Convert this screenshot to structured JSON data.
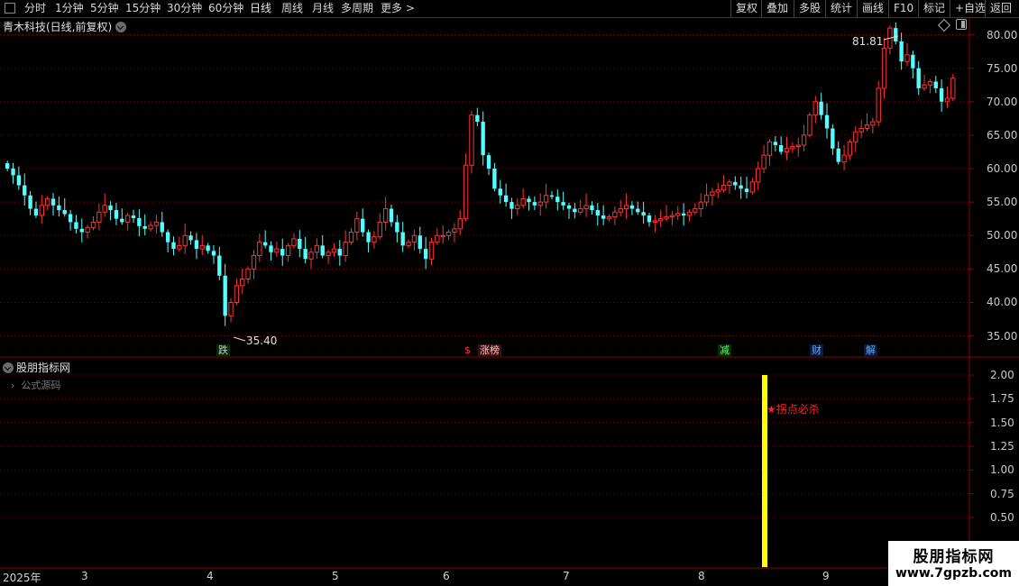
{
  "toolbar": {
    "periods": [
      "分时",
      "1分钟",
      "5分钟",
      "15分钟",
      "30分钟",
      "60分钟",
      "日线",
      "周线",
      "月线",
      "多周期",
      "更多"
    ],
    "active_period": "日线",
    "right_buttons": [
      "复权",
      "叠加",
      "多股",
      "统计",
      "画线",
      "F10",
      "标记",
      "+自选",
      "返回"
    ]
  },
  "main_chart": {
    "title": "青木科技(日线,前复权)",
    "high_label": "81.81",
    "low_label": "35.40",
    "markers": [
      {
        "text": "跌",
        "color": "#00cc00"
      },
      {
        "text": "$",
        "color": "#ff3333"
      },
      {
        "text": "涨榜",
        "color": "#ff3333"
      },
      {
        "text": "减",
        "color": "#00cc00"
      },
      {
        "text": "财",
        "color": "#3399ff"
      },
      {
        "text": "解",
        "color": "#3399ff"
      }
    ]
  },
  "indicator_panel": {
    "title": "股朋指标网",
    "source_label": "公式源码",
    "signal_text": "★拐点必杀",
    "signal_value": 2.0
  },
  "x_axis": [
    "2025年",
    "3",
    "4",
    "5",
    "6",
    "7",
    "8",
    "9"
  ],
  "watermark": {
    "line1": "股朋指标网",
    "line2": "www.7gpzb.com"
  },
  "colors": {
    "up": "#ff3333",
    "down": "#54ffff",
    "signal": "#ffff00",
    "grid": "#8b0000"
  },
  "chart_data": [
    {
      "type": "candlestick",
      "title": "青木科技(日线,前复权)",
      "y_axis_ticks": [
        35.0,
        40.0,
        45.0,
        50.0,
        55.0,
        60.0,
        65.0,
        70.0,
        75.0,
        80.0
      ],
      "ylim": [
        34,
        82.5
      ],
      "x_ticks": [
        "2025年",
        "3",
        "4",
        "5",
        "6",
        "7",
        "8",
        "9"
      ],
      "close": [
        60.0,
        59.0,
        57.5,
        56.0,
        54.0,
        53.0,
        54.5,
        55.5,
        54.5,
        53.8,
        53.2,
        52.0,
        51.0,
        50.5,
        51.2,
        52.0,
        53.5,
        54.5,
        53.8,
        52.5,
        52.0,
        53.0,
        52.6,
        51.4,
        51.0,
        51.5,
        52.0,
        50.5,
        49.0,
        48.0,
        48.5,
        50.0,
        49.3,
        48.0,
        48.5,
        47.7,
        47.0,
        44.0,
        38.0,
        40.0,
        42.5,
        43.5,
        45.0,
        47.0,
        49.0,
        48.5,
        47.5,
        48.0,
        47.0,
        48.5,
        49.5,
        48.0,
        46.5,
        47.5,
        48.5,
        47.0,
        47.5,
        48.0,
        47.0,
        49.0,
        50.5,
        52.5,
        50.5,
        49.0,
        49.8,
        52.0,
        54.0,
        52.0,
        50.5,
        48.5,
        49.0,
        50.0,
        48.0,
        46.5,
        49.0,
        50.0,
        50.0,
        50.5,
        51.0,
        52.5,
        60.5,
        68.0,
        67.0,
        62.0,
        60.0,
        57.0,
        56.0,
        55.0,
        54.0,
        54.5,
        55.5,
        55.0,
        54.5,
        55.0,
        56.0,
        55.8,
        55.0,
        54.5,
        54.0,
        53.5,
        54.0,
        54.5,
        53.8,
        53.0,
        52.5,
        52.8,
        53.5,
        54.0,
        54.5,
        54.0,
        53.5,
        53.0,
        52.0,
        52.2,
        52.5,
        52.8,
        53.0,
        53.3,
        53.0,
        53.5,
        54.0,
        55.0,
        56.0,
        56.5,
        56.8,
        57.5,
        58.0,
        57.5,
        57.0,
        56.5,
        58.0,
        60.0,
        62.0,
        64.0,
        63.5,
        62.5,
        63.0,
        63.3,
        63.5,
        65.0,
        68.0,
        70.0,
        68.0,
        66.0,
        63.0,
        61.0,
        62.0,
        64.0,
        65.5,
        66.0,
        66.5,
        67.0,
        72.0,
        78.0,
        81.0,
        79.0,
        76.0,
        77.0,
        75.0,
        72.0,
        72.5,
        73.0,
        72.0,
        70.0,
        70.5,
        73.5
      ]
    },
    {
      "type": "bar",
      "title": "股朋指标网",
      "y_axis_ticks": [
        0.5,
        0.75,
        1.0,
        1.25,
        1.5,
        1.75,
        2.0
      ],
      "signal": {
        "label": "★拐点必杀",
        "value": 2.0
      }
    }
  ]
}
